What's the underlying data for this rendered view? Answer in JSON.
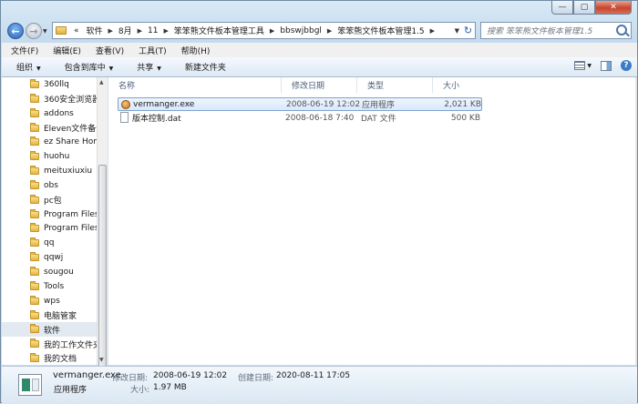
{
  "address": {
    "crumbs": [
      "«",
      "软件",
      "8月",
      "11",
      "笨笨熊文件板本管理工具",
      "bbswjbbgl",
      "笨笨熊文件板本管理1.5"
    ]
  },
  "search": {
    "placeholder": "搜索 笨笨熊文件板本管理1.5"
  },
  "menu": [
    "文件(F)",
    "编辑(E)",
    "查看(V)",
    "工具(T)",
    "帮助(H)"
  ],
  "commands": {
    "organize": "组织",
    "include": "包含到库中",
    "share": "共享",
    "new_folder": "新建文件夹"
  },
  "nav": {
    "items": [
      "360llq",
      "360安全浏览器",
      "addons",
      "Eleven文件备份",
      "ez Share Hom",
      "huohu",
      "meituxiuxiu",
      "obs",
      "pc包",
      "Program Files",
      "Program Files",
      "qq",
      "qqwj",
      "sougou",
      "Tools",
      "wps",
      "电脑管家",
      "软件",
      "我的工作文件夹",
      "我的文档"
    ],
    "selected_index": 17
  },
  "columns": {
    "name": "名称",
    "date": "修改日期",
    "type": "类型",
    "size": "大小"
  },
  "files": [
    {
      "name": "vermanger.exe",
      "date": "2008-06-19 12:02",
      "type": "应用程序",
      "size": "2,021 KB",
      "icon": "app-icon",
      "selected": true
    },
    {
      "name": "版本控制.dat",
      "date": "2008-06-18 7:40",
      "type": "DAT 文件",
      "size": "500 KB",
      "icon": "file-icon",
      "selected": false
    }
  ],
  "details": {
    "name": "vermanger.exe",
    "type": "应用程序",
    "modified_label": "修改日期:",
    "modified": "2008-06-19 12:02",
    "created_label": "创建日期:",
    "created": "2020-08-11 17:05",
    "size_label": "大小:",
    "size": "1.97 MB"
  },
  "colors": {
    "accent": "#2a66b8",
    "selection": "#d9e9fb",
    "chrome": "#c6dcee"
  }
}
